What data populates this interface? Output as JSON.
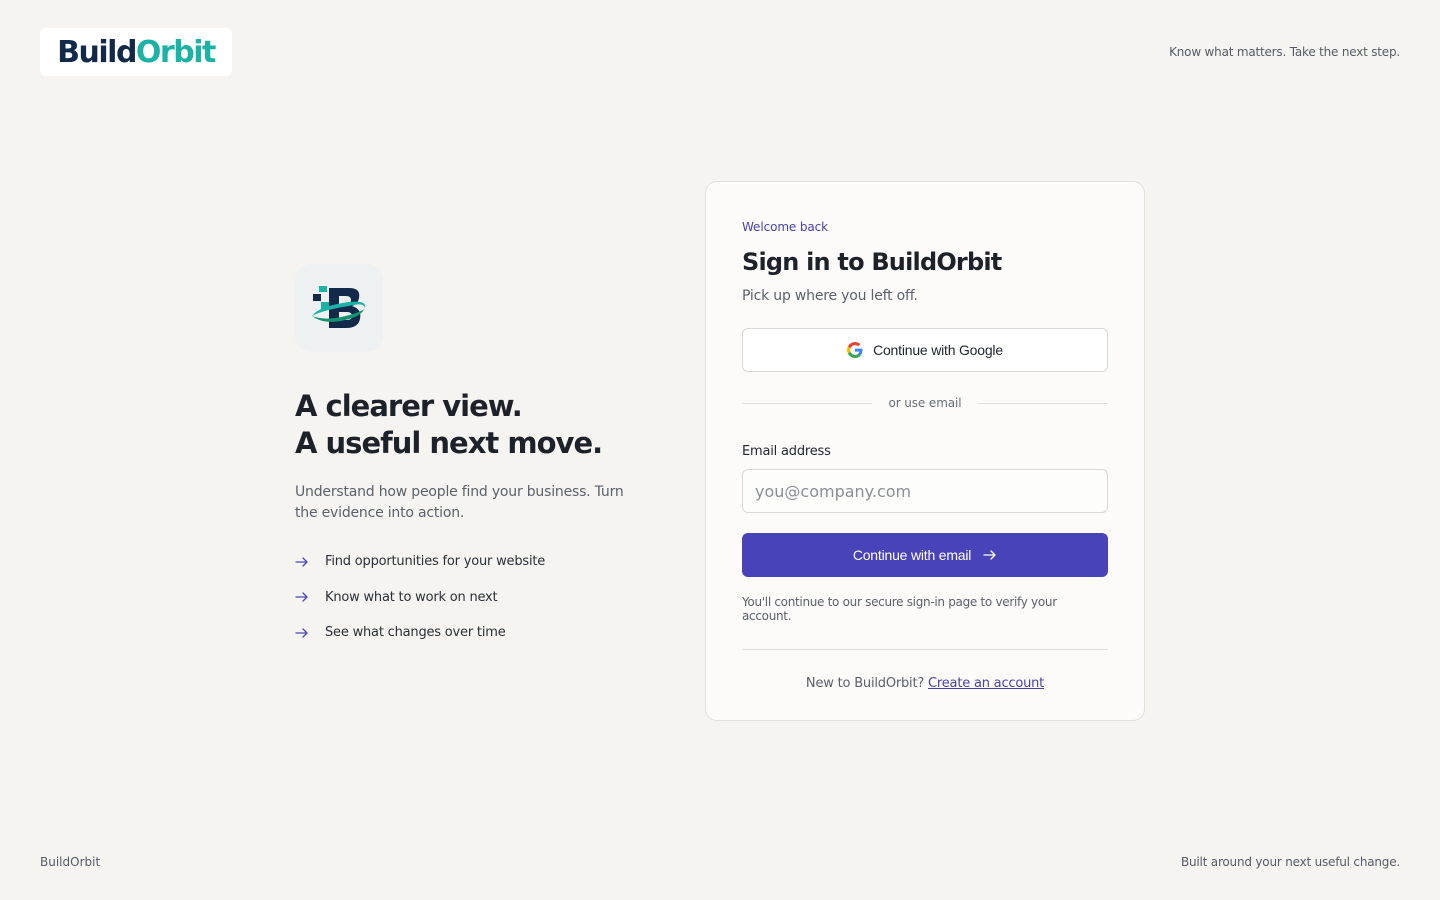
{
  "header": {
    "logo_part1": "Build",
    "logo_part2": "Orbit",
    "tagline": "Know what matters. Take the next step."
  },
  "hero": {
    "icon": "buildorbit-app-icon",
    "headline_line1": "A clearer view.",
    "headline_line2": "A useful next move.",
    "subtext": "Understand how people find your business. Turn the evidence into action.",
    "features": [
      "Find opportunities for your website",
      "Know what to work on next",
      "See what changes over time"
    ]
  },
  "signin": {
    "eyebrow": "Welcome back",
    "title": "Sign in to BuildOrbit",
    "subtitle": "Pick up where you left off.",
    "google_label": "Continue with Google",
    "divider_text": "or use email",
    "email_label": "Email address",
    "email_placeholder": "you@company.com",
    "email_value": "",
    "submit_label": "Continue with email",
    "note": "You'll continue to our secure sign-in page to verify your account.",
    "signup_prompt": "New to BuildOrbit?",
    "signup_link": "Create an account"
  },
  "footer": {
    "left": "BuildOrbit",
    "right": "Built around your next useful change."
  },
  "colors": {
    "background": "#f5f4f1",
    "brand_navy": "#13294a",
    "brand_teal": "#1bb3a5",
    "accent": "#4843b8"
  }
}
